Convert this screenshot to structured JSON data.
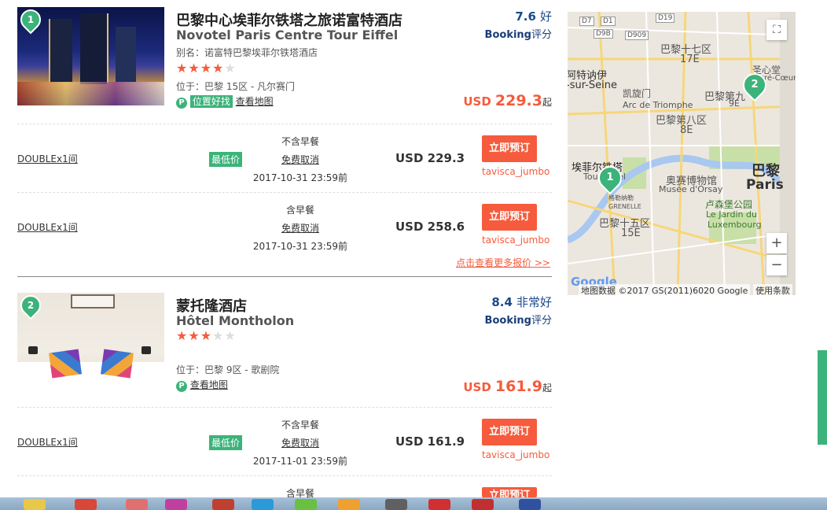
{
  "hotels": [
    {
      "number": "1",
      "name_cn": "巴黎中心埃菲尔铁塔之旅诺富特酒店",
      "name_en": "Novotel Paris Centre Tour Eiffel",
      "alias": "别名：诺富特巴黎埃菲尔铁塔酒店",
      "stars": 4,
      "location": "位于：巴黎 15区 - 凡尔赛门",
      "parking_icon": "P",
      "good_location_badge": "位置好找",
      "view_map": "查看地图",
      "score": "7.6",
      "score_word": "好",
      "booking_label": "Booking",
      "score_suffix": "评分",
      "price_currency": "USD",
      "price_value": "229.3",
      "price_suffix": "起",
      "rooms": [
        {
          "type": "DOUBLE",
          "qty": "x1间",
          "lowest_badge": "最低价",
          "breakfast": "不含早餐",
          "cancel": "免费取消",
          "deadline": "2017-10-31 23:59前",
          "price": "USD 229.3",
          "button": "立即预订",
          "supplier": "tavisca_jumbo"
        },
        {
          "type": "DOUBLE",
          "qty": "x1间",
          "lowest_badge": "",
          "breakfast": "含早餐",
          "cancel": "免费取消",
          "deadline": "2017-10-31 23:59前",
          "price": "USD 258.6",
          "button": "立即预订",
          "supplier": "tavisca_jumbo"
        }
      ],
      "more_quotes": "点击查看更多报价 >>"
    },
    {
      "number": "2",
      "name_cn": "蒙托隆酒店",
      "name_en": "Hôtel Montholon",
      "stars": 3,
      "location": "位于：巴黎 9区 - 歌剧院",
      "parking_icon": "P",
      "view_map": "查看地图",
      "score": "8.4",
      "score_word": "非常好",
      "booking_label": "Booking",
      "score_suffix": "评分",
      "price_currency": "USD",
      "price_value": "161.9",
      "price_suffix": "起",
      "rooms": [
        {
          "type": "DOUBLE",
          "qty": "x1间",
          "lowest_badge": "最低价",
          "breakfast": "不含早餐",
          "cancel": "免费取消",
          "deadline": "2017-11-01 23:59前",
          "price": "USD 161.9",
          "button": "立即预订",
          "supplier": "tavisca_jumbo"
        },
        {
          "breakfast": "含早餐",
          "button": "立即预订"
        }
      ]
    }
  ],
  "map": {
    "labels": {
      "d7": "D7",
      "d1": "D1",
      "d19": "D19",
      "d9b": "D9B",
      "d909": "D909",
      "arr17_cn": "巴黎十七区",
      "arr17": "17E",
      "levallois": "阿特讷伊",
      "sur_seine": "-sur-Seine",
      "arc_cn": "凯旋门",
      "arc_en": "Arc de Triomphe",
      "arr8_cn": "巴黎第八区",
      "arr8": "8E",
      "arr9_cn": "巴黎第九",
      "arr9": "9E",
      "sacre_cn": "圣心堂",
      "sacre_en": "Sacré-Cœur",
      "eiffel_cn": "埃菲尔铁塔",
      "eiffel_en": "Tour Eiffel",
      "orsay_cn": "奥赛博物馆",
      "orsay_en": "Musée d'Orsay",
      "paris_cn": "巴黎",
      "paris_en": "Paris",
      "lux_cn": "卢森堡公园",
      "lux_en1": "Le Jardin du",
      "lux_en2": "Luxembourg",
      "grenelle_cn": "格勒纳勒",
      "grenelle": "GRENELLE",
      "arr15_cn": "巴黎十五区",
      "arr15": "15E"
    },
    "pins": [
      "1",
      "2"
    ],
    "zoom_in": "+",
    "zoom_out": "−",
    "google": "Google",
    "attribution": "地图数据 ©2017 GS(2011)6020 Google",
    "terms": "使用条款"
  }
}
